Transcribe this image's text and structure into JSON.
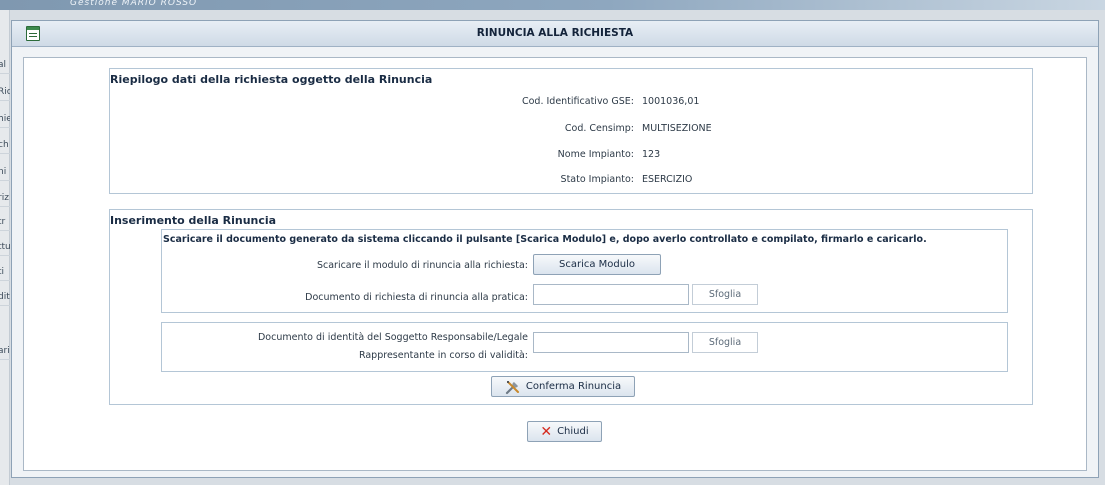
{
  "background": {
    "top_text": "Gestione     MARIO ROSSO",
    "left_items": [
      "al",
      "Ric",
      "hie",
      "ch",
      "ni",
      "riz",
      "tr",
      "ttu",
      "ti",
      "dit",
      "ari"
    ]
  },
  "dialog": {
    "title": "RINUNCIA ALLA RICHIESTA",
    "summary": {
      "legend": "Riepilogo dati della richiesta oggetto della Rinuncia",
      "rows": [
        {
          "label": "Cod. Identificativo GSE:",
          "value": "1001036,01"
        },
        {
          "label": "Cod. Censimp:",
          "value": "MULTISEZIONE"
        },
        {
          "label": "Nome Impianto:",
          "value": "123"
        },
        {
          "label": "Stato Impianto:",
          "value": "ESERCIZIO"
        }
      ]
    },
    "insert": {
      "legend": "Inserimento della Rinuncia",
      "instructions": "Scaricare il documento generato da sistema cliccando il pulsante [Scarica Modulo] e, dopo averlo controllato e compilato, firmarlo e caricarlo.",
      "download_label": "Scaricare il modulo di rinuncia alla richiesta:",
      "download_button": "Scarica Modulo",
      "doc_label": "Documento di richiesta di rinuncia alla pratica:",
      "doc_browse": "Sfoglia",
      "id_label_line1": "Documento di identità del Soggetto Responsabile/Legale",
      "id_label_line2": "Rappresentante in corso di validità:",
      "id_browse": "Sfoglia",
      "confirm_button": "Conferma Rinuncia"
    },
    "close_button": "Chiudi"
  }
}
